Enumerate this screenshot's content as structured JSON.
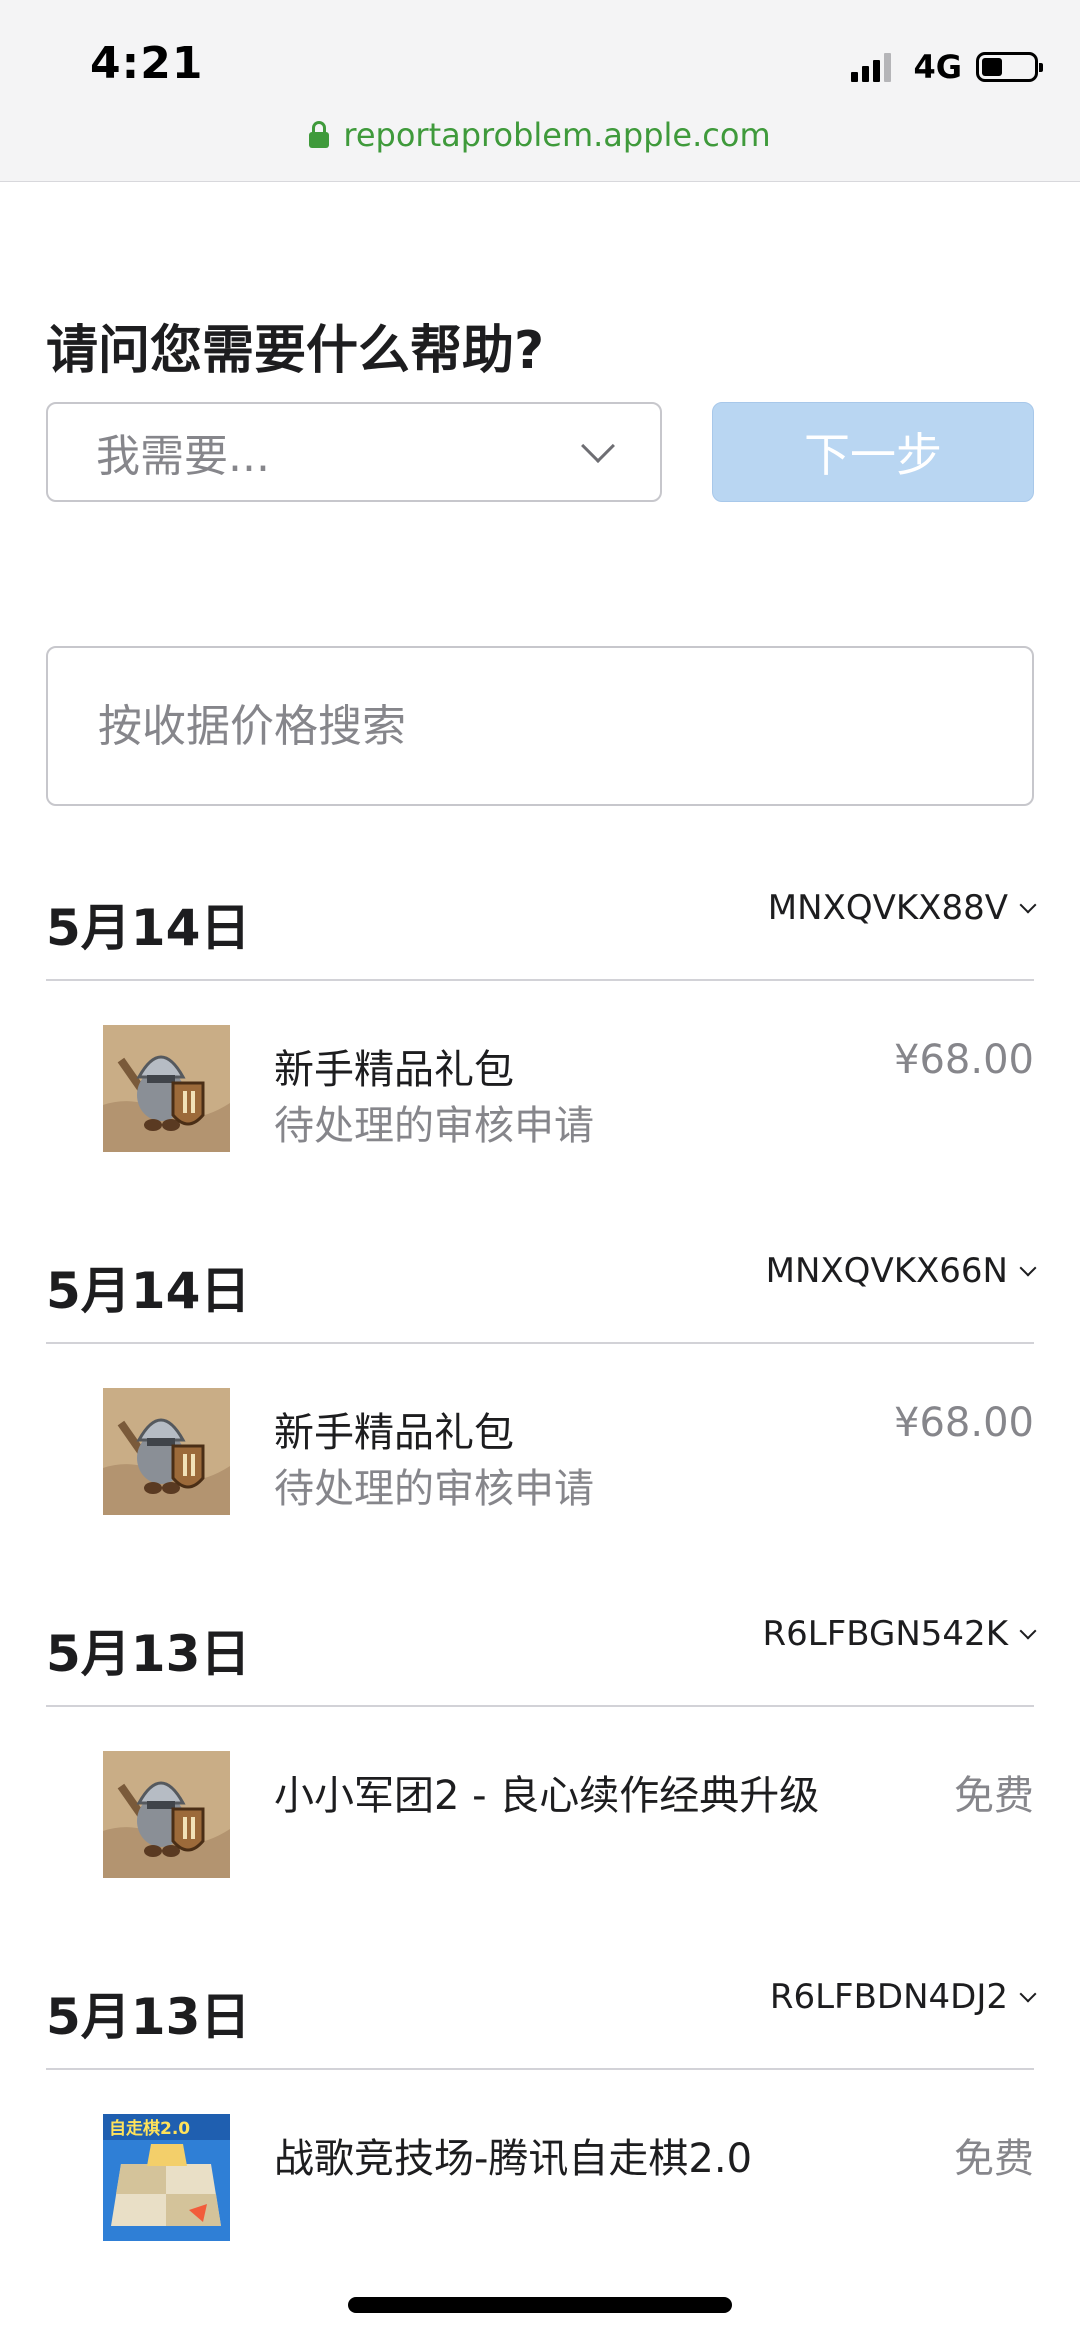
{
  "status_bar": {
    "time": "4:21",
    "network": "4G",
    "battery_level": 0.4
  },
  "browser": {
    "url": "reportaproblem.apple.com",
    "secure": true,
    "accent_color": "#3f9a3b"
  },
  "help": {
    "title": "请问您需要什么帮助?",
    "select_placeholder": "我需要...",
    "next_label": "下一步"
  },
  "search": {
    "placeholder": "按收据价格搜索",
    "value": ""
  },
  "purchases": [
    {
      "date": "5月14日",
      "order_id": "MNXQVKX88V",
      "item": {
        "icon": "knight-game-icon",
        "name": "新手精品礼包",
        "status": "待处理的审核申请",
        "price": "¥68.00"
      }
    },
    {
      "date": "5月14日",
      "order_id": "MNXQVKX66N",
      "item": {
        "icon": "knight-game-icon",
        "name": "新手精品礼包",
        "status": "待处理的审核申请",
        "price": "¥68.00"
      }
    },
    {
      "date": "5月13日",
      "order_id": "R6LFBGN542K",
      "item": {
        "icon": "knight-game-icon",
        "name": "小小军团2 - 良心续作经典升级",
        "status": "",
        "price": "免费"
      }
    },
    {
      "date": "5月13日",
      "order_id": "R6LFBDN4DJ2",
      "item": {
        "icon": "chess-game-icon",
        "name": "战歌竞技场-腾讯自走棋2.0",
        "status": "",
        "price": "免费",
        "icon_badge": "自走棋2.0"
      }
    }
  ],
  "colors": {
    "next_button_bg": "#b9d6f2",
    "divider": "#d2d2d7",
    "secondary_text": "#86868b"
  }
}
